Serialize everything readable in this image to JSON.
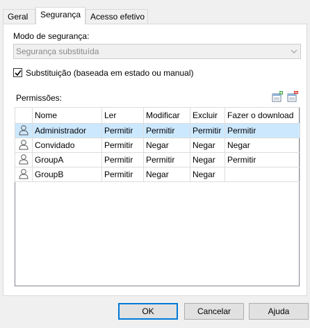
{
  "tabs": [
    {
      "label": "Geral"
    },
    {
      "label": "Segurança"
    },
    {
      "label": "Acesso efetivo"
    }
  ],
  "security": {
    "mode_label": "Modo de segurança:",
    "mode_value": "Segurança substituída",
    "override_label": "Substituição (baseada em estado ou manual)",
    "override_checked": true,
    "permissions_label": "Permissões:"
  },
  "table": {
    "columns": [
      "Nome",
      "Ler",
      "Modificar",
      "Excluir",
      "Fazer o download"
    ],
    "rows": [
      {
        "name": "Administrador",
        "read": "Permitir",
        "modify": "Permitir",
        "delete": "Permitir",
        "download": "Permitir"
      },
      {
        "name": "Convidado",
        "read": "Permitir",
        "modify": "Negar",
        "delete": "Negar",
        "download": "Negar"
      },
      {
        "name": "GroupA",
        "read": "Permitir",
        "modify": "Permitir",
        "delete": "Negar",
        "download": "Permitir"
      },
      {
        "name": "GroupB",
        "read": "Permitir",
        "modify": "Negar",
        "delete": "Negar",
        "download": ""
      }
    ],
    "selected_row": 0
  },
  "buttons": {
    "ok": "OK",
    "cancel": "Cancelar",
    "help": "Ajuda"
  },
  "icons": {
    "add_permission": "add-permission-icon",
    "remove_permission": "remove-permission-icon",
    "user": "user-icon"
  }
}
